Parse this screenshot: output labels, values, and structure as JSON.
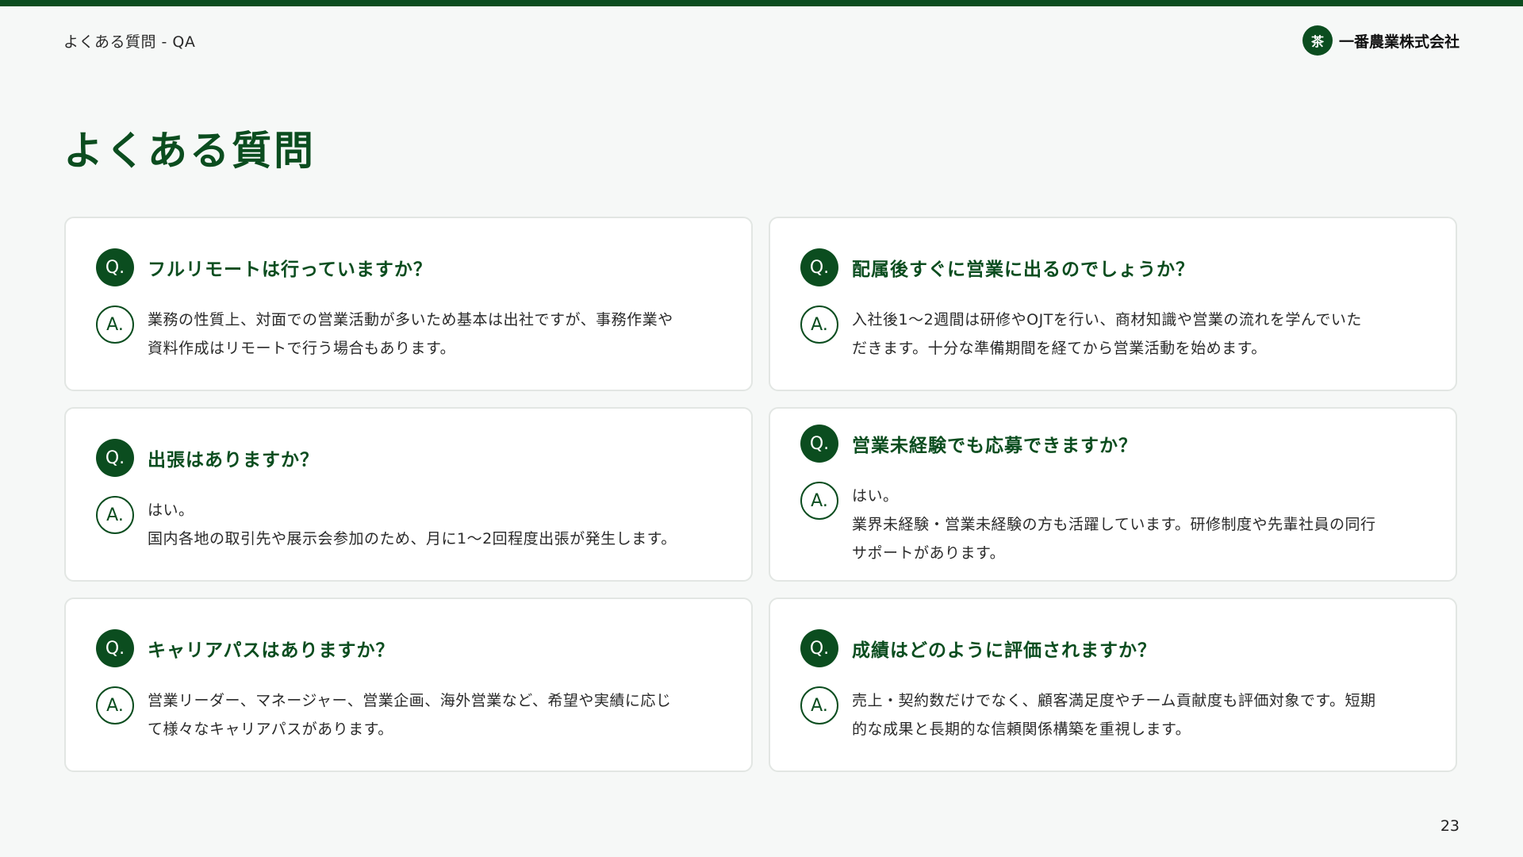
{
  "header": {
    "label": "よくある質問 - QA",
    "company_name": "一番農業株式会社",
    "logo_mark": "茶"
  },
  "page_title": "よくある質問",
  "badges": {
    "question": "Q.",
    "answer": "A."
  },
  "faq": [
    {
      "question": "フルリモートは行っていますか？",
      "answer_lines": [
        "業務の性質上、対面での営業活動が多いため基本は出社ですが、事務作業や",
        "資料作成はリモートで行う場合もあります。"
      ]
    },
    {
      "question": "配属後すぐに営業に出るのでしょうか？",
      "answer_lines": [
        "入社後1〜2週間は研修やOJTを行い、商材知識や営業の流れを学んでいた",
        "だきます。十分な準備期間を経てから営業活動を始めます。"
      ]
    },
    {
      "question": "出張はありますか？",
      "answer_lines": [
        "はい。",
        "国内各地の取引先や展示会参加のため、月に1〜2回程度出張が発生します。"
      ]
    },
    {
      "question": "営業未経験でも応募できますか？",
      "answer_lines": [
        "はい。",
        "業界未経験・営業未経験の方も活躍しています。研修制度や先輩社員の同行",
        "サポートがあります。"
      ]
    },
    {
      "question": "キャリアパスはありますか？",
      "answer_lines": [
        "営業リーダー、マネージャー、営業企画、海外営業など、希望や実績に応じ",
        "て様々なキャリアパスがあります。"
      ]
    },
    {
      "question": "成績はどのように評価されますか？",
      "answer_lines": [
        "売上・契約数だけでなく、顧客満足度やチーム貢献度も評価対象です。短期",
        "的な成果と長期的な信頼関係構築を重視します。"
      ]
    }
  ],
  "page_number": "23",
  "colors": {
    "brand_green": "#0b4d1f",
    "background": "#f6f8f7",
    "card": "#ffffff"
  }
}
